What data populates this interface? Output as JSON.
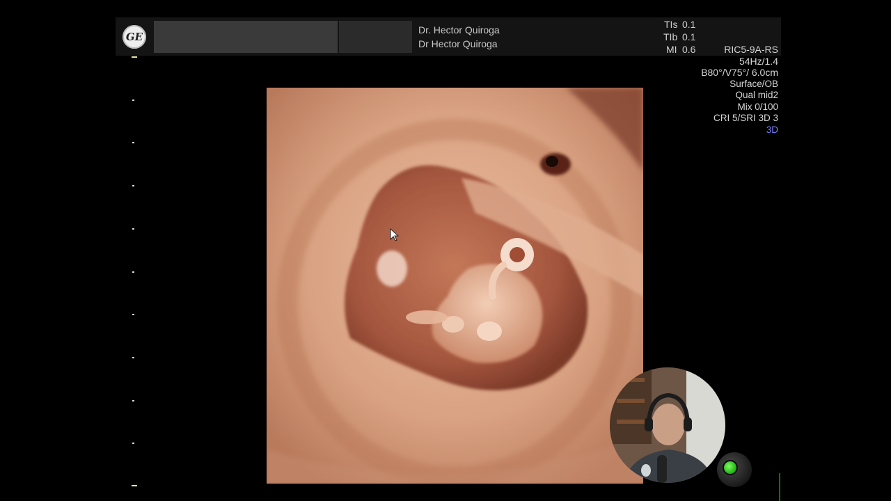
{
  "header": {
    "doctor_line1": "Dr. Hector Quiroga",
    "doctor_line2": "Dr Hector Quiroga"
  },
  "indices": [
    {
      "label": "TIs",
      "value": "0.1"
    },
    {
      "label": "TIb",
      "value": "0.1"
    },
    {
      "label": "MI",
      "value": "0.6"
    }
  ],
  "probe": "RIC5-9A-RS",
  "params": {
    "frame_rate": "54Hz/1.4",
    "volume": "B80°/V75°/ 6.0cm",
    "preset": "Surface/OB",
    "quality": "Qual mid2",
    "mix": "Mix 0/100",
    "cri": "CRI 5/SRI 3D 3",
    "mode": "3D"
  },
  "colors": {
    "background": "#000000",
    "header": "#141414",
    "mode_label": "#7c7cff",
    "status_led": "#3cd62a"
  }
}
